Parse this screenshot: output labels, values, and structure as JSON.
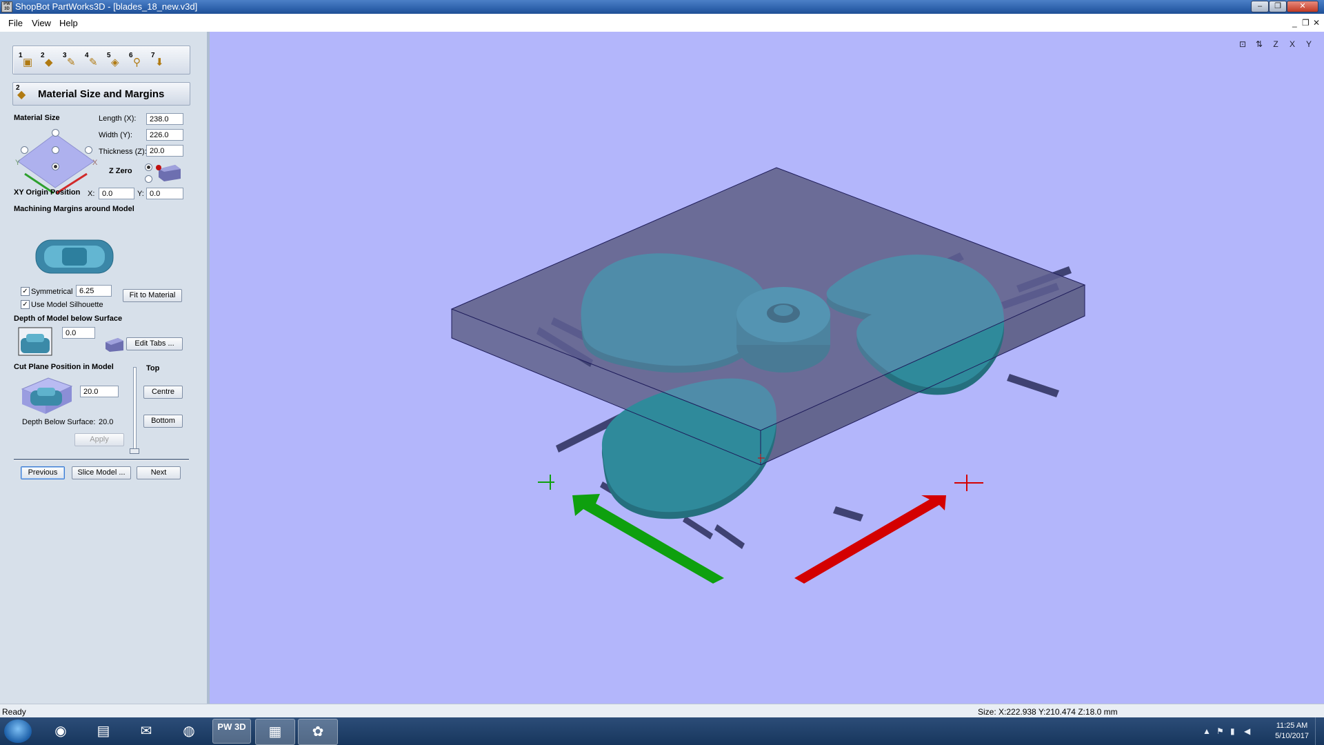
{
  "window": {
    "app_icon": "PW 3D",
    "title": "ShopBot PartWorks3D - [blades_18_new.v3d]",
    "controls": {
      "minimize": "–",
      "restore": "❐",
      "close": "✕"
    },
    "mdi_controls": {
      "minimize": "_",
      "restore": "❐",
      "close": "✕"
    }
  },
  "menu": {
    "items": [
      "File",
      "View",
      "Help"
    ]
  },
  "stage_bar": {
    "stages": [
      {
        "num": "1",
        "icon": "model-icon"
      },
      {
        "num": "2",
        "icon": "material-icon"
      },
      {
        "num": "3",
        "icon": "toolpath-icon"
      },
      {
        "num": "4",
        "icon": "finish-icon"
      },
      {
        "num": "5",
        "icon": "tabs-icon"
      },
      {
        "num": "6",
        "icon": "preview-icon"
      },
      {
        "num": "7",
        "icon": "save-icon"
      }
    ]
  },
  "section": {
    "number": "2",
    "title": "Material Size and Margins"
  },
  "material_size": {
    "label": "Material Size",
    "length_label": "Length (X):",
    "length": "238.0",
    "width_label": "Width (Y):",
    "width": "226.0",
    "thickness_label": "Thickness (Z):",
    "thickness": "20.0",
    "z_zero_label": "Z Zero",
    "axis_x": "X",
    "axis_y": "Y"
  },
  "xy_origin": {
    "label": "XY Origin Position",
    "x_label": "X:",
    "x": "0.0",
    "y_label": "Y:",
    "y": "0.0"
  },
  "margins": {
    "label": "Machining Margins around Model",
    "symmetrical_label": "Symmetrical",
    "symmetrical_checked": true,
    "value": "6.25",
    "use_silhouette_label": "Use Model Silhouette",
    "use_silhouette_checked": true,
    "fit_button": "Fit to Material"
  },
  "depth": {
    "label": "Depth of Model below Surface",
    "value": "0.0",
    "edit_tabs_button": "Edit Tabs ..."
  },
  "cut_plane": {
    "label": "Cut Plane Position in Model",
    "top_label": "Top",
    "value": "20.0",
    "centre_button": "Centre",
    "bottom_button": "Bottom",
    "depth_below_label": "Depth Below Surface:",
    "depth_below_value": "20.0",
    "apply_button": "Apply"
  },
  "nav": {
    "previous": "Previous",
    "slice": "Slice Model ...",
    "next": "Next"
  },
  "view_toolbar": [
    "fit-view-icon",
    "iso-view-icon",
    "z-view-icon",
    "x-view-icon",
    "y-view-icon"
  ],
  "view_labels": {
    "z": "Z",
    "x": "X",
    "y": "Y"
  },
  "status": {
    "left": "Ready",
    "right": "Size: X:222.938 Y:210.474 Z:18.0 mm"
  },
  "taskbar": {
    "items": [
      "chrome-icon",
      "explorer-icon",
      "files-icon",
      "firefox-icon",
      "partworks3d-icon",
      "vcarve-icon",
      "paint-icon"
    ],
    "pw3d_label": "PW 3D",
    "clock_time": "11:25 AM",
    "clock_date": "5/10/2017"
  },
  "colors": {
    "viewport_bg": "#b3b6fb",
    "model": "#2f8a9b",
    "x_arrow": "#d40000",
    "y_arrow": "#0ea00e",
    "material_box": "#5a5a8a"
  }
}
